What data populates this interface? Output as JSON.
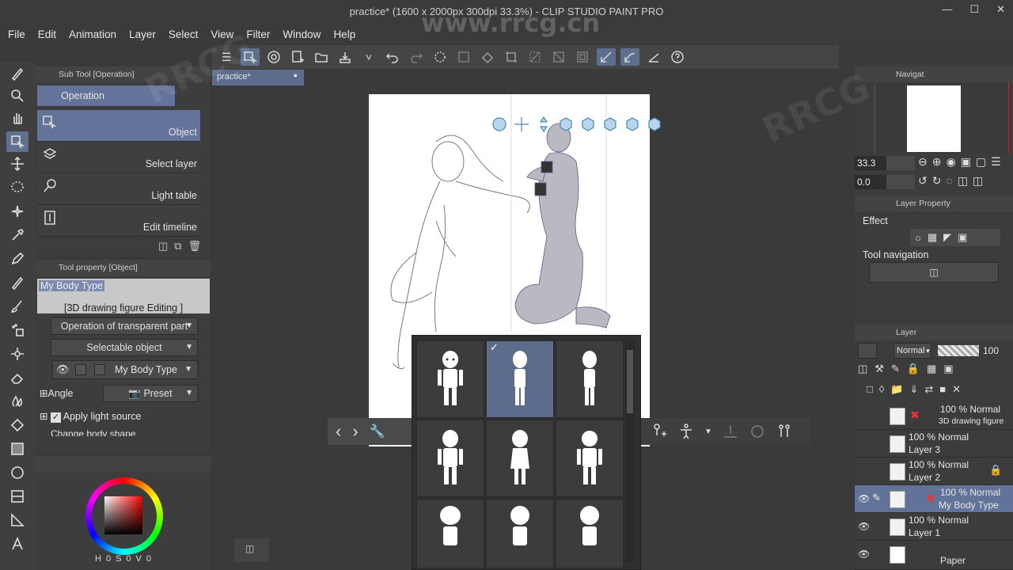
{
  "window": {
    "title": "practice* (1600 x 2000px 300dpi 33.3%)  - CLIP STUDIO PAINT PRO",
    "watermark_text": "www.rrcg.cn"
  },
  "menu": [
    "File",
    "Edit",
    "Animation",
    "Layer",
    "Select",
    "View",
    "Filter",
    "Window",
    "Help"
  ],
  "canvas_tab": {
    "label": "practice*"
  },
  "sub_tool": {
    "header": "Sub Tool [Operation]",
    "group": "Operation",
    "items": [
      {
        "label": "Object",
        "icon": "object-cursor-icon",
        "selected": true
      },
      {
        "label": "Select layer",
        "icon": "select-layer-icon",
        "selected": false
      },
      {
        "label": "Light table",
        "icon": "light-table-icon",
        "selected": false
      },
      {
        "label": "Edit timeline",
        "icon": "timeline-icon",
        "selected": false
      }
    ]
  },
  "tool_property": {
    "header": "Tool property [Object]",
    "name": "My Body Type",
    "mode": "[3D drawing figure Editing ]",
    "transparent_part": "Operation of transparent part",
    "selectable": "Selectable object",
    "body_type": "My Body Type",
    "angle_label": "Angle",
    "preset_label": "Preset",
    "light_label": "Apply light source",
    "body_shape_label": "Change body shape"
  },
  "color": {
    "h_label": "H",
    "h": "0",
    "s_label": "S",
    "s": "0",
    "v_label": "V",
    "v": "0",
    "main_color": "#000000",
    "sub_color": "#f2c200"
  },
  "navigator": {
    "header": "Navigat",
    "zoom": "33.3",
    "rotation": "0.0"
  },
  "layer_property": {
    "header": "Layer Property",
    "effect_label": "Effect",
    "tool_nav_label": "Tool navigation"
  },
  "layer_panel": {
    "header": "Layer",
    "blend_mode": "Normal",
    "opacity": "100",
    "layers": [
      {
        "opacity_mode": "100 % Normal",
        "name": "3D drawing figure",
        "selected": false,
        "visible": false
      },
      {
        "opacity_mode": "100 % Normal",
        "name": "Layer 3",
        "selected": false,
        "visible": false
      },
      {
        "opacity_mode": "100 % Normal",
        "name": "Layer 2",
        "selected": false,
        "visible": false
      },
      {
        "opacity_mode": "100 % Normal",
        "name": "My Body Type",
        "selected": true,
        "visible": true
      },
      {
        "opacity_mode": "100 % Normal",
        "name": "Layer 1",
        "selected": false,
        "visible": true
      },
      {
        "opacity_mode": "",
        "name": "Paper",
        "selected": false,
        "visible": true
      }
    ]
  },
  "body_popup": {
    "selected_index": 1,
    "count": 9
  }
}
